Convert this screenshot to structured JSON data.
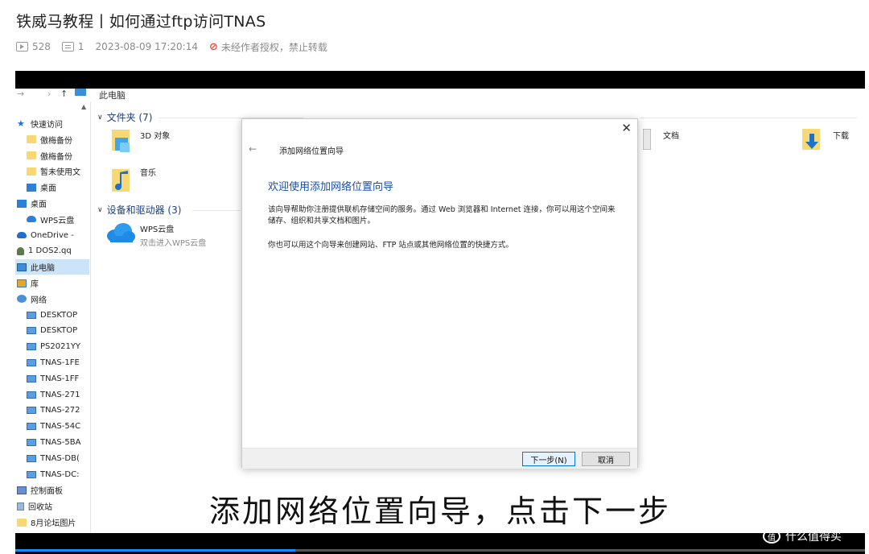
{
  "article": {
    "title": "铁威马教程丨如何通过ftp访问TNAS",
    "views": "528",
    "comments": "1",
    "datetime": "2023-08-09 17:20:14",
    "copyright_notice": "未经作者授权，禁止转载"
  },
  "explorer": {
    "breadcrumb": "此电脑",
    "sidebar": [
      {
        "label": "快速访问",
        "icon": "star-icon"
      },
      {
        "label": "傲梅备份",
        "icon": "folder-icon"
      },
      {
        "label": "傲梅备份",
        "icon": "folder-icon"
      },
      {
        "label": "暂未使用文",
        "icon": "folder-icon"
      },
      {
        "label": "桌面",
        "icon": "desktop-icon"
      },
      {
        "label": "桌面",
        "icon": "desktop-icon"
      },
      {
        "label": "WPS云盘",
        "icon": "cloud-icon"
      },
      {
        "label": "OneDrive -",
        "icon": "onedrive-icon"
      },
      {
        "label": "1 DOS2.qq",
        "icon": "user-icon"
      },
      {
        "label": "此电脑",
        "icon": "computer-icon"
      },
      {
        "label": "库",
        "icon": "library-icon"
      },
      {
        "label": "网络",
        "icon": "network-icon"
      },
      {
        "label": "DESKTOP",
        "icon": "monitor-icon"
      },
      {
        "label": "DESKTOP",
        "icon": "monitor-icon"
      },
      {
        "label": "PS2021YY",
        "icon": "monitor-icon"
      },
      {
        "label": "TNAS-1FE",
        "icon": "monitor-icon"
      },
      {
        "label": "TNAS-1FF",
        "icon": "monitor-icon"
      },
      {
        "label": "TNAS-271",
        "icon": "monitor-icon"
      },
      {
        "label": "TNAS-272",
        "icon": "monitor-icon"
      },
      {
        "label": "TNAS-54C",
        "icon": "monitor-icon"
      },
      {
        "label": "TNAS-5BA",
        "icon": "monitor-icon"
      },
      {
        "label": "TNAS-DB(",
        "icon": "monitor-icon"
      },
      {
        "label": "TNAS-DC:",
        "icon": "monitor-icon"
      },
      {
        "label": "控制面板",
        "icon": "control-panel-icon"
      },
      {
        "label": "回收站",
        "icon": "recycle-bin-icon"
      },
      {
        "label": "8月论坛图片",
        "icon": "folder-icon"
      }
    ],
    "folders_section": "文件夹 (7)",
    "folders": {
      "objects3d": "3D 对象",
      "music": "音乐",
      "documents": "文档",
      "downloads": "下载"
    },
    "devices_section": "设备和驱动器 (3)",
    "wps_drive": {
      "name": "WPS云盘",
      "subtitle": "双击进入WPS云盘"
    }
  },
  "dialog": {
    "close_glyph": "✕",
    "back_glyph": "←",
    "title": "添加网络位置向导",
    "heading": "欢迎使用添加网络位置向导",
    "paragraph1": "该向导帮助你注册提供联机存储空间的服务。通过 Web 浏览器和 Internet 连接，你可以用这个空间来储存、组织和共享文档和图片。",
    "paragraph2": "你也可以用这个向导来创建网站、FTP 站点或其他网络位置的快捷方式。",
    "next_button": "下一步(N)",
    "cancel_button": "取消"
  },
  "video": {
    "subtitle": "添加网络位置向导，点击下一步",
    "progress_fraction": 0.33
  },
  "watermark": {
    "text": "什么值得买",
    "icon_glyph": "值"
  },
  "colors": {
    "accent_blue": "#1b4fa8",
    "selection": "#cce4f7",
    "progress": "#1a8cff",
    "ban_red": "#e34a3c"
  }
}
